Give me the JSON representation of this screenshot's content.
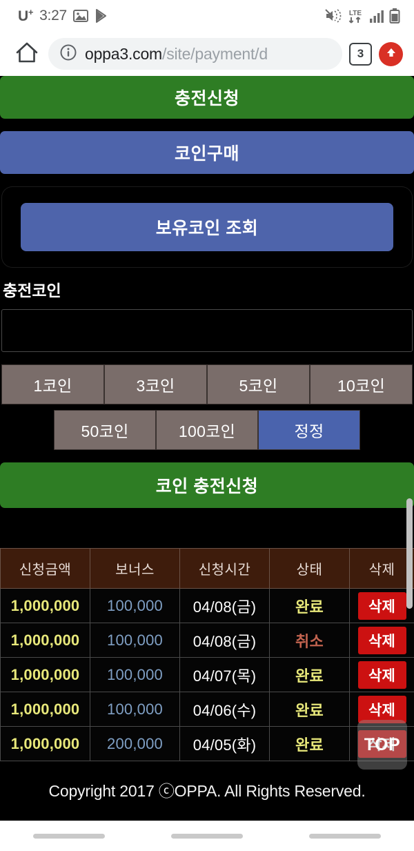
{
  "status_bar": {
    "carrier": "U",
    "carrier_sup": "+",
    "time": "3:27",
    "icons": [
      "image-icon",
      "play-store-icon",
      "volume-mute-icon",
      "lte-data-icon",
      "signal-bars-icon",
      "battery-icon"
    ],
    "lte_label": "LTE"
  },
  "browser": {
    "home_icon": "home-icon",
    "site_info_icon": "info-circle-icon",
    "url_domain": "oppa3.com",
    "url_path": "/site/payment/d",
    "tab_count": "3",
    "update_icon": "up-arrow-icon"
  },
  "page": {
    "top_action": "충전신청",
    "coin_purchase": "코인구매",
    "check_balance": "보유코인 조회",
    "charge_coin_label": "충전코인",
    "charge_coin_value": "",
    "chips_row1": [
      "1코인",
      "3코인",
      "5코인",
      "10코인"
    ],
    "chips_row2": [
      "50코인",
      "100코인"
    ],
    "chip_reset": "정정",
    "submit": "코인 충전신청",
    "top_button": "TOP",
    "footer": "Copyright 2017 ⓒOPPA. All Rights Reserved."
  },
  "table": {
    "headers": [
      "신청금액",
      "보너스",
      "신청시간",
      "상태",
      "삭제"
    ],
    "delete_label": "삭제",
    "rows": [
      {
        "amount": "1,000,000",
        "bonus": "100,000",
        "date": "04/08(금)",
        "state": "완료",
        "state_kind": "done"
      },
      {
        "amount": "1,000,000",
        "bonus": "100,000",
        "date": "04/08(금)",
        "state": "취소",
        "state_kind": "cancel"
      },
      {
        "amount": "1,000,000",
        "bonus": "100,000",
        "date": "04/07(목)",
        "state": "완료",
        "state_kind": "done"
      },
      {
        "amount": "1,000,000",
        "bonus": "100,000",
        "date": "04/06(수)",
        "state": "완료",
        "state_kind": "done"
      },
      {
        "amount": "1,000,000",
        "bonus": "200,000",
        "date": "04/05(화)",
        "state": "완료",
        "state_kind": "done"
      }
    ]
  },
  "colors": {
    "green": "#2e7d24",
    "blue": "#4e64ab",
    "chip_gray": "#7a6d6a",
    "table_header_brown": "#3e1c0c",
    "delete_red": "#cc1111",
    "amount_yellow": "#e8e87a",
    "bonus_blue": "#7f9fc4",
    "cancel_red": "#c2634f"
  }
}
